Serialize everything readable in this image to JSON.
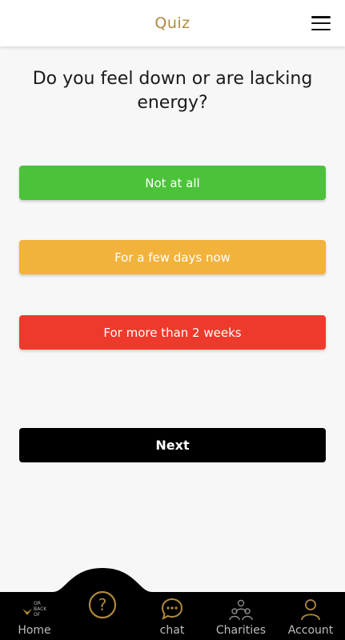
{
  "header": {
    "title": "Quiz",
    "menu_icon": "hamburger-menu-icon"
  },
  "question": {
    "text": "Do you feel down or are lacking energy?"
  },
  "answers": [
    {
      "label": "Not at all",
      "color": "#4cc23a"
    },
    {
      "label": "For a few days now",
      "color": "#f2b33d"
    },
    {
      "label": "For more than 2 weeks",
      "color": "#ee3a2c"
    }
  ],
  "next": {
    "label": "Next"
  },
  "tabbar": {
    "accent": "#b08a3e",
    "logo_text": [
      "OR",
      "BACK",
      "OF"
    ],
    "home": "Home",
    "quiz_icon": "question-mark-icon",
    "chat": "chat",
    "charities": "Charities",
    "account": "Account"
  }
}
